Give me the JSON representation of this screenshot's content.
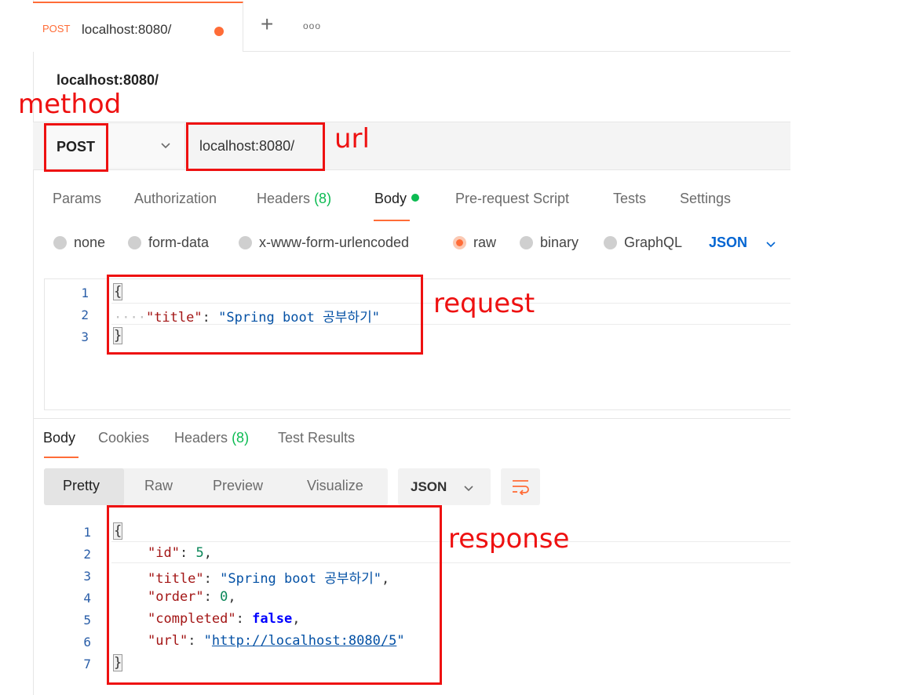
{
  "tab": {
    "method": "POST",
    "title": "localhost:8080/",
    "new_tab": "+",
    "more": "ooo"
  },
  "request_name": "localhost:8080/",
  "url_bar": {
    "method": "POST",
    "url": "localhost:8080/"
  },
  "request_tabs": {
    "params": "Params",
    "authorization": "Authorization",
    "headers": "Headers",
    "headers_count": "(8)",
    "body": "Body",
    "pre_request": "Pre-request Script",
    "tests": "Tests",
    "settings": "Settings"
  },
  "body_types": {
    "none": "none",
    "form_data": "form-data",
    "urlencoded": "x-www-form-urlencoded",
    "raw": "raw",
    "binary": "binary",
    "graphql": "GraphQL",
    "selected": "raw",
    "language": "JSON"
  },
  "request_body": {
    "line_numbers": [
      "1",
      "2",
      "3"
    ],
    "open": "{",
    "indent": "····",
    "key": "\"title\"",
    "colon": ": ",
    "value": "\"Spring boot 공부하기\"",
    "close": "}"
  },
  "response_tabs": {
    "body": "Body",
    "cookies": "Cookies",
    "headers": "Headers",
    "headers_count": "(8)",
    "test_results": "Test Results"
  },
  "response_view": {
    "pretty": "Pretty",
    "raw": "Raw",
    "preview": "Preview",
    "visualize": "Visualize",
    "format": "JSON"
  },
  "response_body": {
    "line_numbers": [
      "1",
      "2",
      "3",
      "4",
      "5",
      "6",
      "7"
    ],
    "open": "{",
    "id_key": "\"id\"",
    "id_val": "5",
    "title_key": "\"title\"",
    "title_val": "\"Spring boot 공부하기\"",
    "order_key": "\"order\"",
    "order_val": "0",
    "completed_key": "\"completed\"",
    "completed_val": "false",
    "url_key": "\"url\"",
    "url_val": "http://localhost:8080/5",
    "close": "}"
  },
  "annotations": {
    "method": "method",
    "url": "url",
    "request": "request",
    "response": "response",
    "color": "#ee1111"
  },
  "colors": {
    "accent": "#ff6c37",
    "count_green": "#0cbb52",
    "json_blue": "#0265d2"
  }
}
